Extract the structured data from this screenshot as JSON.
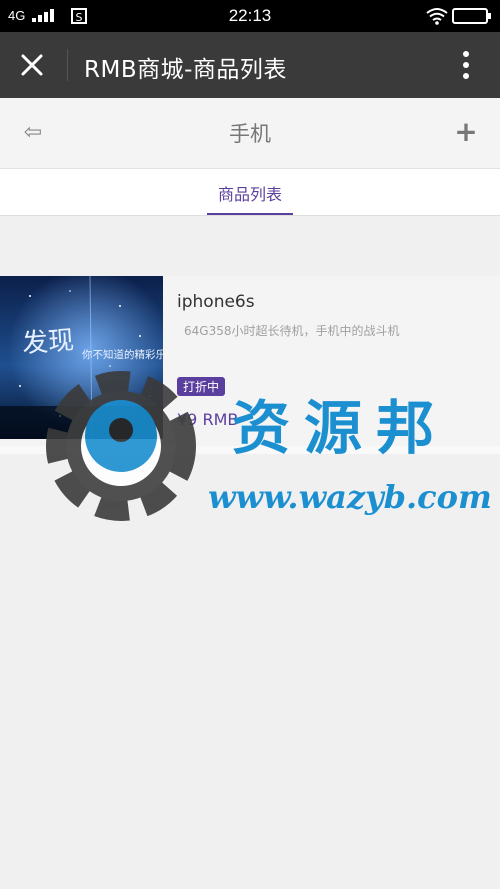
{
  "status_bar": {
    "network": "4G",
    "time": "22:13",
    "sim_icon": "sim-card-icon",
    "wifi_icon": "wifi-icon",
    "battery_icon": "battery-icon"
  },
  "title_bar": {
    "title": "RMB商城-商品列表",
    "close_icon": "close-icon",
    "more_icon": "more-vertical-icon"
  },
  "nav_bar": {
    "back_glyph": "⇦",
    "title": "手机",
    "add_glyph": "+"
  },
  "tabs": [
    {
      "label": "商品列表",
      "active": true
    }
  ],
  "products": [
    {
      "name": "iphone6s",
      "description": "64G358小时超长待机，手机中的战斗机",
      "badge": "打折中",
      "price": "¥9 RMB",
      "image_text_big": "发现",
      "image_text_small": "你不知道的精彩乐视"
    }
  ],
  "watermark": {
    "title": "资源邦",
    "url": "www.wazyb.com"
  },
  "colors": {
    "accent": "#5b3f9e",
    "title_bar_bg": "#3a3a3a",
    "page_bg": "#f0f0f0",
    "watermark_blue": "#1b8fd0"
  }
}
